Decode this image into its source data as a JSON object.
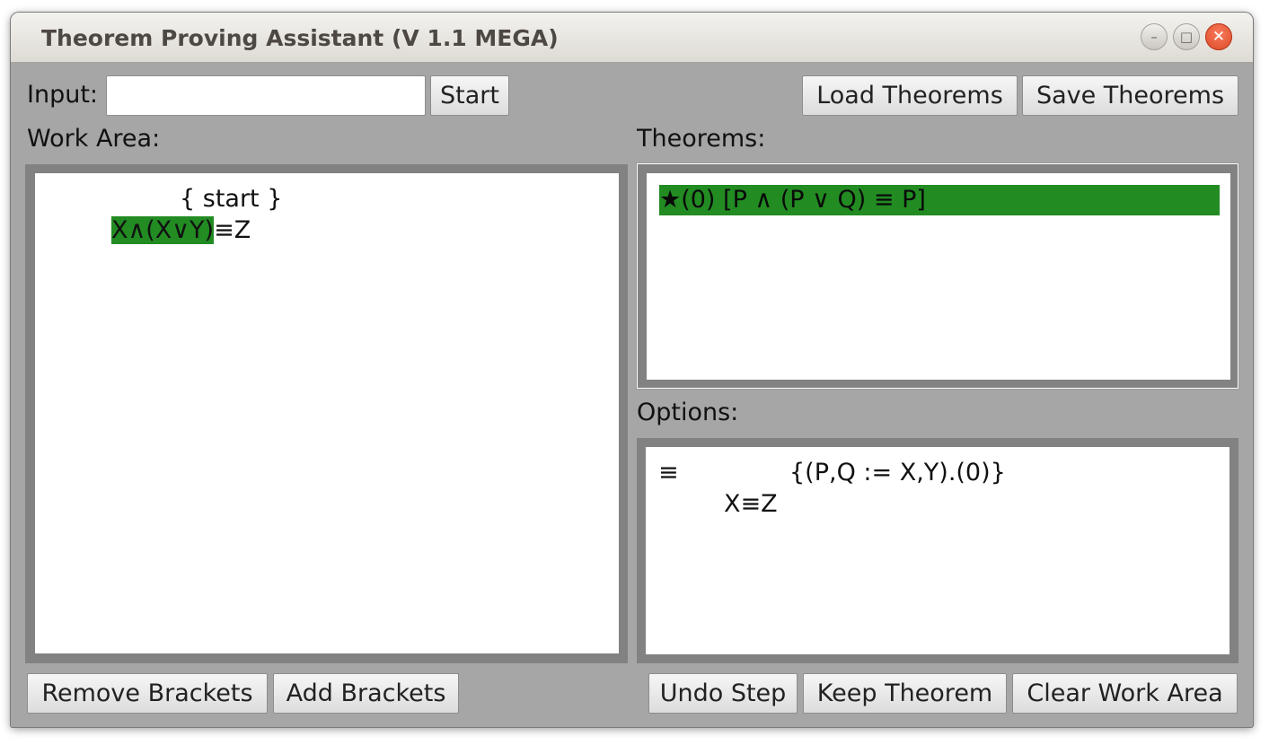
{
  "window": {
    "title": "Theorem Proving Assistant (V 1.1 MEGA)",
    "controls": {
      "minimize": "–",
      "maximize": "□",
      "close": "✕"
    }
  },
  "toolbar": {
    "input_label": "Input:",
    "input_value": "",
    "start_label": "Start",
    "load_label": "Load Theorems",
    "save_label": "Save Theorems"
  },
  "work_area": {
    "heading": "Work Area:",
    "hint": "{ start }",
    "expression_highlighted": "X∧(X∨Y)",
    "expression_rest": "≡Z"
  },
  "theorems": {
    "heading": "Theorems:",
    "items": [
      {
        "text": "★(0) [P ∧ (P ∨ Q) ≡ P]",
        "selected": true
      }
    ]
  },
  "options": {
    "heading": "Options:",
    "operator": "≡",
    "substitution": "{(P,Q := X,Y).(0)}",
    "result": "X≡Z"
  },
  "bottom_buttons": {
    "remove_brackets": "Remove Brackets",
    "add_brackets": "Add Brackets",
    "undo_step": "Undo Step",
    "keep_theorem": "Keep Theorem",
    "clear_work_area": "Clear Work Area"
  },
  "colors": {
    "window_bg": "#a6a6a6",
    "highlight": "#228b22",
    "pane_frame": "#828282",
    "close_button": "#e5532f"
  }
}
